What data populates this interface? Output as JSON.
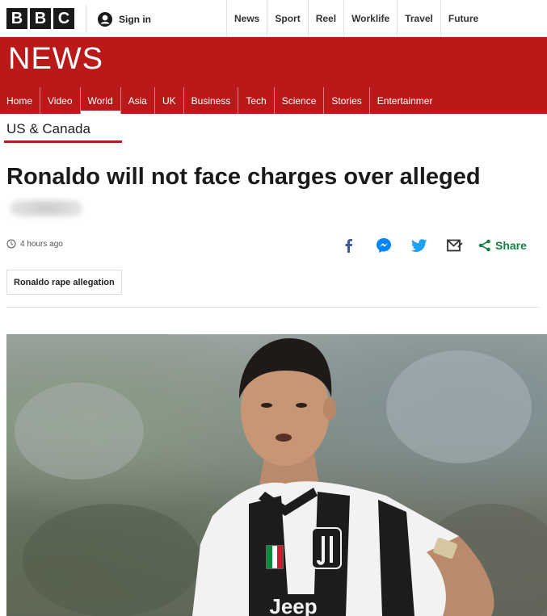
{
  "brand": {
    "letters": [
      "B",
      "B",
      "C"
    ]
  },
  "topbar": {
    "signin_label": "Sign in",
    "nav": [
      "News",
      "Sport",
      "Reel",
      "Worklife",
      "Travel",
      "Future"
    ]
  },
  "newsbar": {
    "title": "NEWS",
    "subnav": [
      "Home",
      "Video",
      "World",
      "Asia",
      "UK",
      "Business",
      "Tech",
      "Science",
      "Stories",
      "Entertainmer"
    ],
    "active_index": 2
  },
  "article": {
    "section": "US & Canada",
    "headline": "Ronaldo will not face charges over alleged",
    "timestamp": "4 hours ago",
    "share_label": "Share",
    "tag": "Ronaldo rape allegation"
  },
  "colors": {
    "brand_red": "#bb1919",
    "share_green": "#1a7f47",
    "facebook": "#3b5998",
    "messenger": "#0084ff",
    "twitter": "#1da1f2"
  },
  "icons": {
    "signin": "user-icon",
    "clock": "clock-icon",
    "facebook": "facebook-icon",
    "messenger": "messenger-icon",
    "twitter": "twitter-icon",
    "email": "email-icon",
    "share": "share-icon"
  }
}
